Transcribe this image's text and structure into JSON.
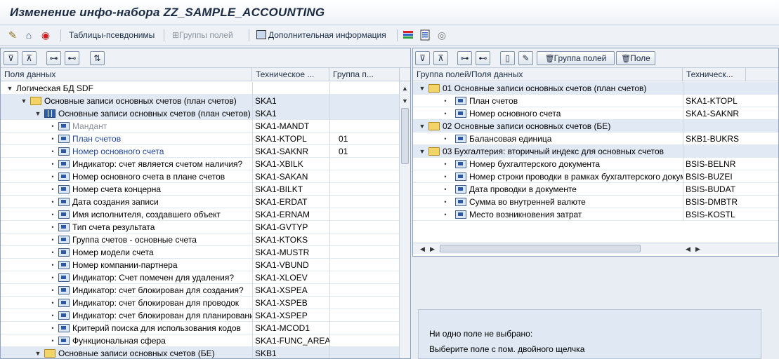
{
  "window": {
    "title": "Изменение инфо-набора ZZ_SAMPLE_ACCOUNTING"
  },
  "toolbar": {
    "items": [
      {
        "icon": "glasses-pencil-icon"
      },
      {
        "icon": "hierarchy-icon"
      },
      {
        "icon": "activate-icon"
      },
      {
        "label": "Таблицы-псевдонимы",
        "enabled": true
      },
      {
        "label": "Группы полей",
        "enabled": false
      },
      {
        "label": "Дополнительная информация",
        "enabled": true
      },
      {
        "icon": "color-bars-icon"
      },
      {
        "icon": "document-list-icon"
      },
      {
        "icon": "info-circle-icon"
      }
    ]
  },
  "left_panel": {
    "columns": [
      "Поля данных",
      "Техническое ...",
      "Группа п..."
    ],
    "rows": [
      {
        "name": "Логическая БД SDF",
        "tech": "",
        "group": "",
        "level": 0,
        "kind": "root",
        "expand": "down",
        "style": "normal"
      },
      {
        "name": "Основные записи основных счетов (план счетов)",
        "tech": "SKA1",
        "group": "",
        "level": 1,
        "kind": "folder",
        "expand": "down",
        "style": "normal"
      },
      {
        "name": "Основные записи основных счетов (план счетов)",
        "tech": "SKA1",
        "group": "",
        "level": 2,
        "kind": "table",
        "expand": "down",
        "style": "normal"
      },
      {
        "name": "Мандант",
        "tech": "SKA1-MANDT",
        "group": "",
        "level": 3,
        "kind": "field",
        "expand": "none",
        "style": "gray"
      },
      {
        "name": "План счетов",
        "tech": "SKA1-KTOPL",
        "group": "01",
        "level": 3,
        "kind": "field",
        "expand": "none",
        "style": "blue"
      },
      {
        "name": "Номер основного счета",
        "tech": "SKA1-SAKNR",
        "group": "01",
        "level": 3,
        "kind": "field",
        "expand": "none",
        "style": "blue"
      },
      {
        "name": "Индикатор: счет является счетом наличия?",
        "tech": "SKA1-XBILK",
        "group": "",
        "level": 3,
        "kind": "field",
        "expand": "none",
        "style": "normal"
      },
      {
        "name": "Номер основного счета в плане счетов",
        "tech": "SKA1-SAKAN",
        "group": "",
        "level": 3,
        "kind": "field",
        "expand": "none",
        "style": "normal"
      },
      {
        "name": "Номер счета концерна",
        "tech": "SKA1-BILKT",
        "group": "",
        "level": 3,
        "kind": "field",
        "expand": "none",
        "style": "normal"
      },
      {
        "name": "Дата создания записи",
        "tech": "SKA1-ERDAT",
        "group": "",
        "level": 3,
        "kind": "field",
        "expand": "none",
        "style": "normal"
      },
      {
        "name": "Имя исполнителя, создавшего объект",
        "tech": "SKA1-ERNAM",
        "group": "",
        "level": 3,
        "kind": "field",
        "expand": "none",
        "style": "normal"
      },
      {
        "name": "Тип счета результата",
        "tech": "SKA1-GVTYP",
        "group": "",
        "level": 3,
        "kind": "field",
        "expand": "none",
        "style": "normal"
      },
      {
        "name": "Группа счетов - основные счета",
        "tech": "SKA1-KTOKS",
        "group": "",
        "level": 3,
        "kind": "field",
        "expand": "none",
        "style": "normal"
      },
      {
        "name": "Номер модели счета",
        "tech": "SKA1-MUSTR",
        "group": "",
        "level": 3,
        "kind": "field",
        "expand": "none",
        "style": "normal"
      },
      {
        "name": "Номер компании-партнера",
        "tech": "SKA1-VBUND",
        "group": "",
        "level": 3,
        "kind": "field",
        "expand": "none",
        "style": "normal"
      },
      {
        "name": "Индикатор: Счет помечен для удаления?",
        "tech": "SKA1-XLOEV",
        "group": "",
        "level": 3,
        "kind": "field",
        "expand": "none",
        "style": "normal"
      },
      {
        "name": "Индикатор: счет блокирован для создания?",
        "tech": "SKA1-XSPEA",
        "group": "",
        "level": 3,
        "kind": "field",
        "expand": "none",
        "style": "normal"
      },
      {
        "name": "Индикатор: счет блокирован для проводок",
        "tech": "SKA1-XSPEB",
        "group": "",
        "level": 3,
        "kind": "field",
        "expand": "none",
        "style": "normal"
      },
      {
        "name": "Индикатор: счет блокирован для планирования",
        "tech": "SKA1-XSPEP",
        "group": "",
        "level": 3,
        "kind": "field",
        "expand": "none",
        "style": "normal"
      },
      {
        "name": "Критерий поиска для использования кодов",
        "tech": "SKA1-MCOD1",
        "group": "",
        "level": 3,
        "kind": "field",
        "expand": "none",
        "style": "normal"
      },
      {
        "name": "Функциональная сфера",
        "tech": "SKA1-FUNC_AREA",
        "group": "",
        "level": 3,
        "kind": "field",
        "expand": "none",
        "style": "normal"
      },
      {
        "name": "Основные записи основных счетов (БЕ)",
        "tech": "SKB1",
        "group": "",
        "level": 2,
        "kind": "folder",
        "expand": "down",
        "style": "normal"
      }
    ]
  },
  "right_panel": {
    "buttons": [
      "Группа полей",
      "Поле"
    ],
    "columns": [
      "Группа полей/Поля данных",
      "Техническ..."
    ],
    "rows": [
      {
        "name": "01 Основные записи основных счетов (план счетов)",
        "tech": "",
        "level": 0,
        "kind": "folder"
      },
      {
        "name": "План счетов",
        "tech": "SKA1-KTOPL",
        "level": 1,
        "kind": "field"
      },
      {
        "name": "Номер основного счета",
        "tech": "SKA1-SAKNR",
        "level": 1,
        "kind": "field"
      },
      {
        "name": "02 Основные записи основных счетов (БЕ)",
        "tech": "",
        "level": 0,
        "kind": "folder"
      },
      {
        "name": "Балансовая единица",
        "tech": "SKB1-BUKRS",
        "level": 1,
        "kind": "field"
      },
      {
        "name": "03 Бухгалтерия: вторичный индекс для основных счетов",
        "tech": "",
        "level": 0,
        "kind": "folder"
      },
      {
        "name": "Номер бухгалтерского документа",
        "tech": "BSIS-BELNR",
        "level": 1,
        "kind": "field"
      },
      {
        "name": "Номер строки проводки в рамках бухгалтерского документа",
        "tech": "BSIS-BUZEI",
        "level": 1,
        "kind": "field"
      },
      {
        "name": "Дата проводки в документе",
        "tech": "BSIS-BUDAT",
        "level": 1,
        "kind": "field"
      },
      {
        "name": "Сумма во внутренней валюте",
        "tech": "BSIS-DMBTR",
        "level": 1,
        "kind": "field"
      },
      {
        "name": "Место возникновения затрат",
        "tech": "BSIS-KOSTL",
        "level": 1,
        "kind": "field"
      }
    ]
  },
  "message": {
    "line1": "Ни одно поле не выбрано:",
    "line2": "Выберите поле с пом. двойного щелчка"
  }
}
